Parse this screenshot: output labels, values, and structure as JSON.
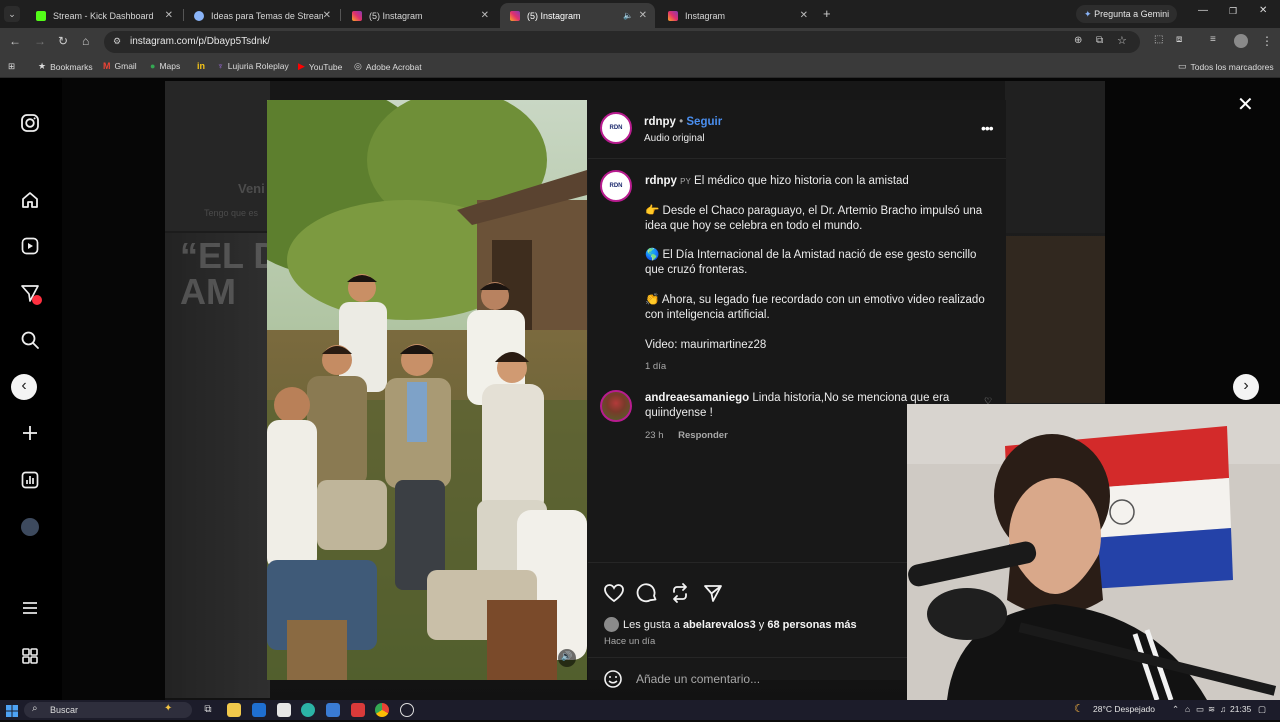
{
  "browser": {
    "tabs": [
      {
        "title": "Stream - Kick Dashboard",
        "color": "#53fc18"
      },
      {
        "title": "Ideas para Temas de Stream - C",
        "color": "#8ab4f8"
      },
      {
        "title": "(5) Instagram",
        "color": "#e1306c"
      },
      {
        "title": "(5) Instagram",
        "color": "#e1306c"
      },
      {
        "title": "Instagram",
        "color": "#e1306c"
      }
    ],
    "gemini_label": "Pregunta a Gemini",
    "url": "instagram.com/p/Dbayp5Tsdnk/",
    "bookmarks": [
      {
        "label": "Bookmarks",
        "icon": "star-icon"
      },
      {
        "label": "Gmail",
        "icon": "gmail-icon"
      },
      {
        "label": "Maps",
        "icon": "maps-icon"
      },
      {
        "label": "",
        "icon": "imdb-icon"
      },
      {
        "label": "Lujuria Roleplay",
        "icon": "bookmark-icon"
      },
      {
        "label": "YouTube",
        "icon": "youtube-icon"
      },
      {
        "label": "Adobe Acrobat",
        "icon": "acrobat-icon"
      }
    ],
    "all_bookmarks": "Todos los marcadores"
  },
  "background": {
    "headline": "“EL D\nAM",
    "side_text_1": "Veni",
    "side_text_2": "Tengo que es"
  },
  "post": {
    "author": "rdnpy",
    "follow_label": "Seguir",
    "audio_label": "Audio original",
    "avatar_text": "RDN",
    "caption_prefix": "PY",
    "caption_title": "El médico que hizo historia con la amistad",
    "caption_lines": [
      "👉 Desde el Chaco paraguayo, el Dr. Artemio Bracho impulsó una idea que hoy se celebra en todo el mundo.",
      "🌎 El Día Internacional de la Amistad nació de ese gesto sencillo que cruzó fronteras.",
      "👏 Ahora, su legado fue recordado con un emotivo video realizado con inteligencia artificial."
    ],
    "video_credit": "Video: maurimartinez28",
    "posted_ago": "1 día",
    "comment": {
      "author": "andreaesamaniego",
      "text": "Linda historia,No se menciona que era quiindyense !",
      "ago": "23 h",
      "reply_label": "Responder"
    },
    "likes_prefix": "Les gusta a",
    "likes_user": "abelarevalos3",
    "likes_connector": "y",
    "likes_others": "68 personas más",
    "posted_label": "Hace un día",
    "comment_placeholder": "Añade un comentario..."
  },
  "taskbar": {
    "search_placeholder": "Buscar",
    "weather": "28°C Despejado",
    "time": "21:35"
  }
}
